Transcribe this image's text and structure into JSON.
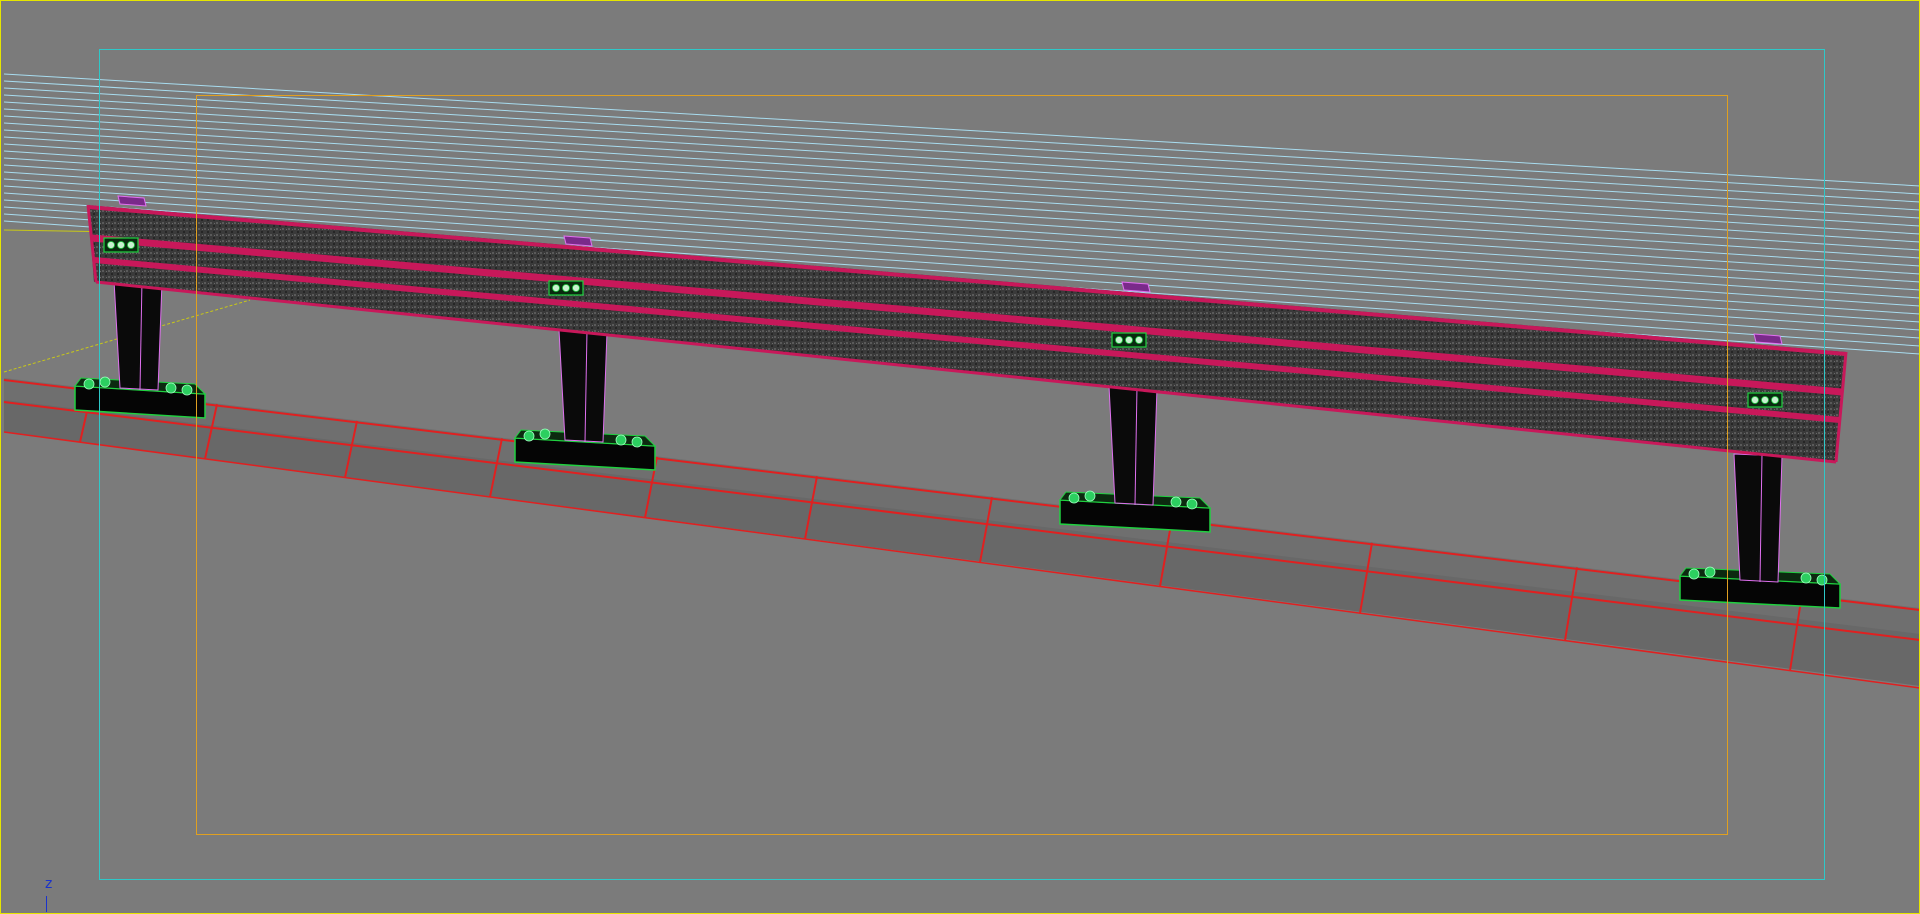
{
  "viewport": {
    "axis_indicator_label": "z",
    "frame_colors": {
      "active_border": "#e6e600",
      "safe_outer": "#2ec8c8",
      "safe_inner": "#e0a020"
    }
  },
  "scene": {
    "background_color": "#7b7b7b",
    "rail_color": "#3c3c3c",
    "rail_edge_color": "#c8185a",
    "post_color": "#0a0a0a",
    "post_edge_color": "#e070f0",
    "base_edge_color": "#20d040",
    "curb_edge_color": "#e02020",
    "background_lines_color": "#a8dcef",
    "post_count": 4
  }
}
